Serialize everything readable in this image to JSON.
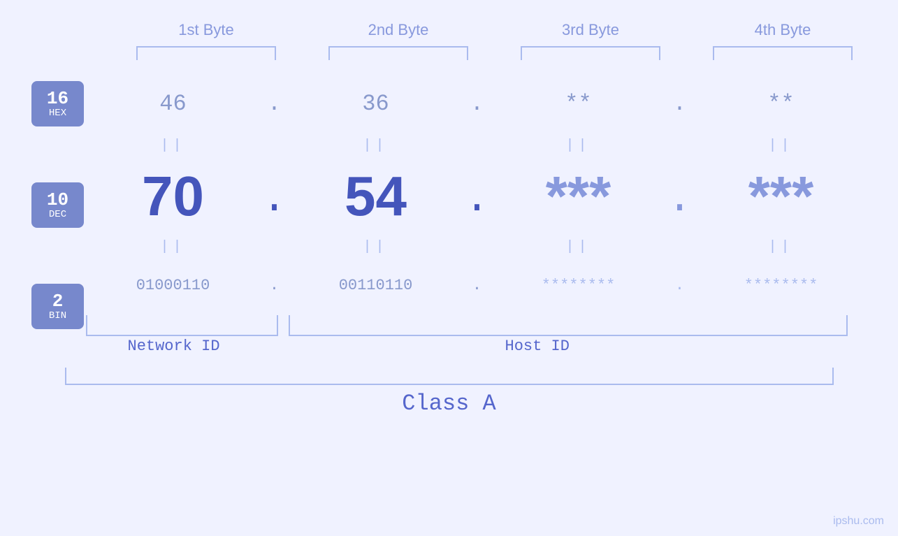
{
  "bytes": {
    "headers": [
      "1st Byte",
      "2nd Byte",
      "3rd Byte",
      "4th Byte"
    ],
    "labels": [
      {
        "top": "16",
        "bottom": "HEX"
      },
      {
        "top": "10",
        "bottom": "DEC"
      },
      {
        "top": "2",
        "bottom": "BIN"
      }
    ],
    "hex": {
      "values": [
        "46",
        "36",
        "**",
        "**"
      ],
      "dots": [
        ".",
        ".",
        ".",
        ""
      ]
    },
    "dec": {
      "values": [
        "70",
        "54",
        "***",
        "***"
      ],
      "dots": [
        ".",
        ".",
        ".",
        ""
      ]
    },
    "bin": {
      "values": [
        "01000110",
        "00110110",
        "********",
        "********"
      ],
      "dots": [
        ".",
        ".",
        ".",
        ""
      ]
    }
  },
  "equals": "||",
  "labels": {
    "network_id": "Network ID",
    "host_id": "Host ID",
    "class": "Class A"
  },
  "watermark": "ipshu.com"
}
